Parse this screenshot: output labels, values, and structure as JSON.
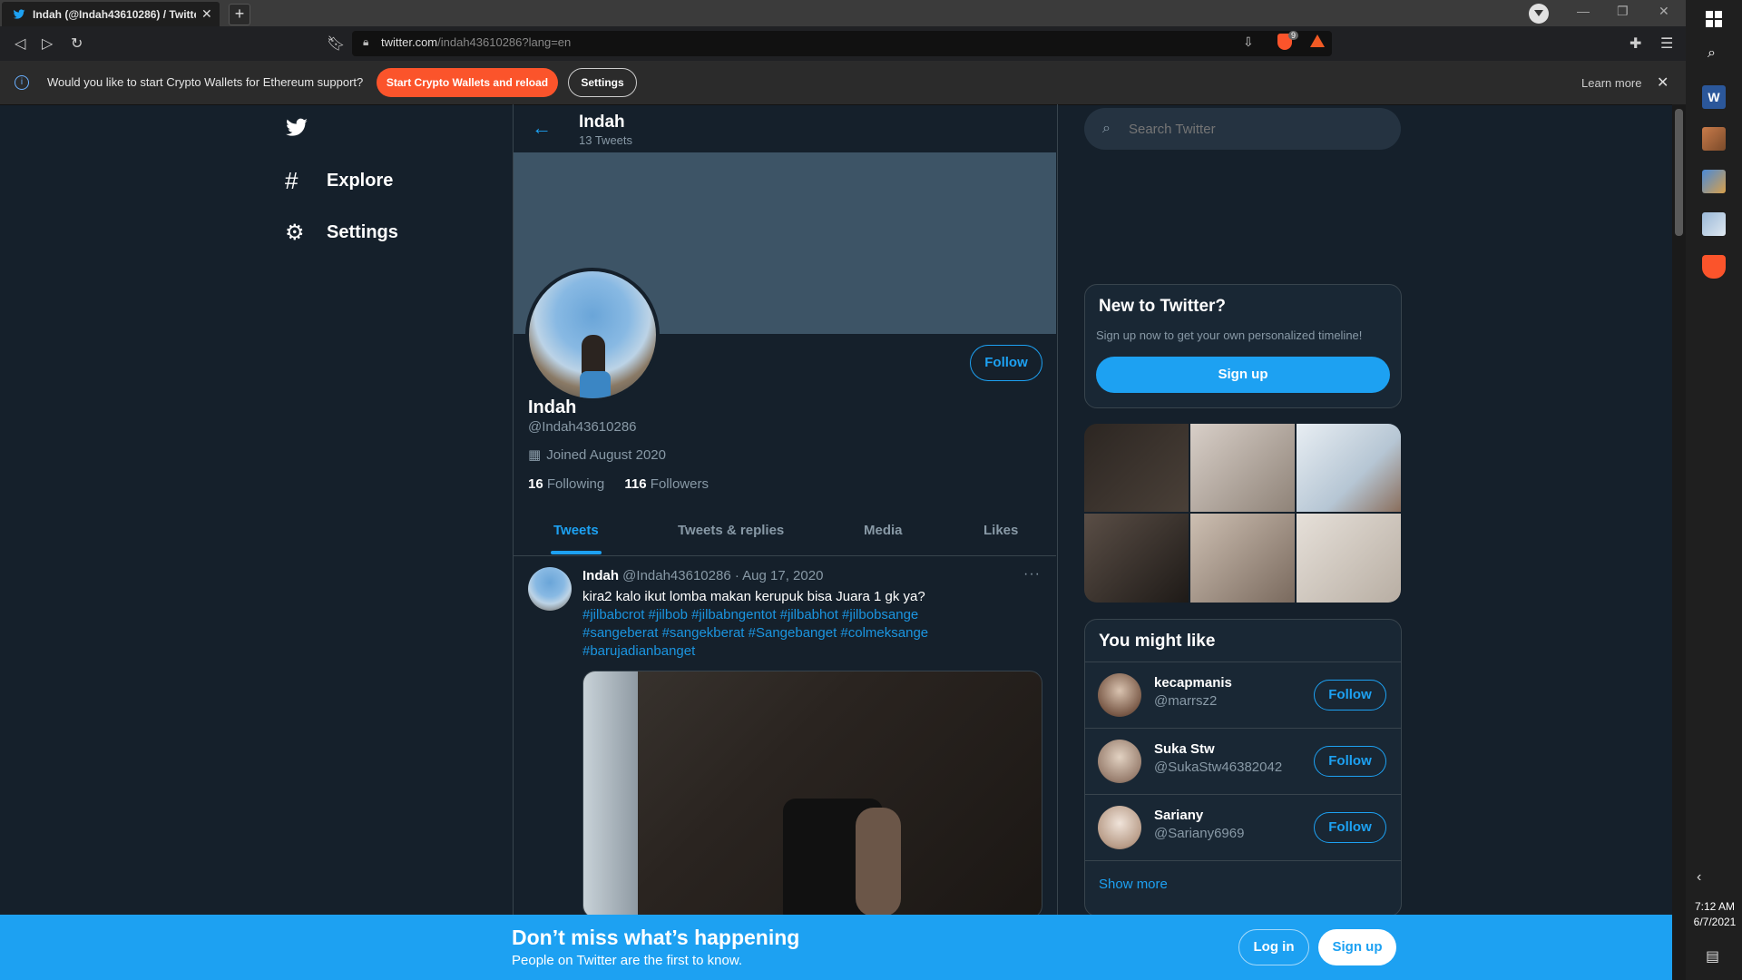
{
  "browser": {
    "tab_title": "Indah (@Indah43610286) / Twitter",
    "new_tab": "+",
    "url_main": "twitter.com",
    "url_rest": "/indah43610286?lang=en",
    "shield_count": "9"
  },
  "infobar": {
    "message": "Would you like to start Crypto Wallets for Ethereum support?",
    "primary_button": "Start Crypto Wallets and reload",
    "settings_button": "Settings",
    "learn_more": "Learn more"
  },
  "nav": {
    "explore": "Explore",
    "settings": "Settings"
  },
  "profile_header": {
    "name": "Indah",
    "tweet_count": "13 Tweets"
  },
  "profile": {
    "name": "Indah",
    "handle": "@Indah43610286",
    "joined": "Joined August 2020",
    "following_count": "16",
    "following_label": "Following",
    "followers_count": "116",
    "followers_label": "Followers",
    "follow_button": "Follow"
  },
  "tabs": [
    "Tweets",
    "Tweets & replies",
    "Media",
    "Likes"
  ],
  "tweet": {
    "name": "Indah",
    "handle_time": "@Indah43610286 · Aug 17, 2020",
    "text": "kira2 kalo ikut lomba makan kerupuk bisa Juara 1 gk ya?",
    "tags_line1": "#jilbabcrot #jilbob #jilbabngentot #jilbabhot #jilbobsange",
    "tags_line2": "#sangeberat #sangekberat #Sangebanget #colmeksange",
    "tags_line3": "#barujadianbanget"
  },
  "search": {
    "placeholder": "Search Twitter"
  },
  "new_to_twitter": {
    "title": "New to Twitter?",
    "subtitle": "Sign up now to get your own personalized timeline!",
    "button": "Sign up"
  },
  "suggestions": {
    "title": "You might like",
    "items": [
      {
        "name": "kecapmanis",
        "handle": "@marrsz2",
        "button": "Follow"
      },
      {
        "name": "Suka Stw",
        "handle": "@SukaStw46382042",
        "button": "Follow"
      },
      {
        "name": "Sariany",
        "handle": "@Sariany6969",
        "button": "Follow"
      }
    ],
    "show_more": "Show more"
  },
  "bottom_bar": {
    "title": "Don’t miss what’s happening",
    "subtitle": "People on Twitter are the first to know.",
    "login": "Log in",
    "signup": "Sign up"
  },
  "taskbar": {
    "time": "7:12 AM",
    "date": "6/7/2021"
  },
  "colors": {
    "twitter_blue": "#1da1f2",
    "background": "#15202b",
    "brave_orange": "#fb542b"
  }
}
